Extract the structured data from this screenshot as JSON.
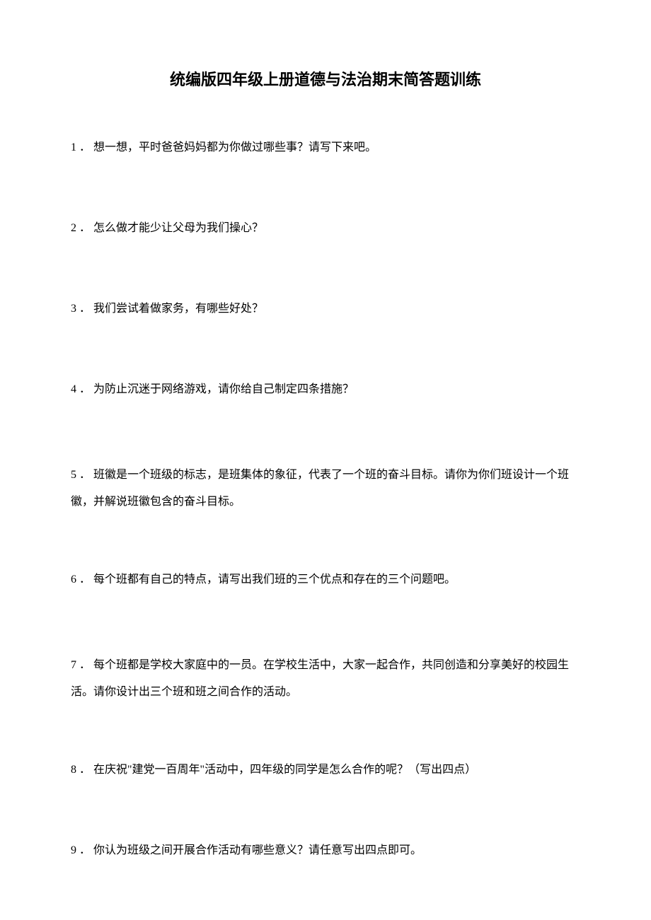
{
  "title": "统编版四年级上册道德与法治期末简答题训练",
  "questions": [
    {
      "num": "1",
      "text": "想一想，平时爸爸妈妈都为你做过哪些事？请写下来吧。"
    },
    {
      "num": "2",
      "text": "怎么做才能少让父母为我们操心？"
    },
    {
      "num": "3",
      "text": "我们尝试着做家务，有哪些好处？"
    },
    {
      "num": "4",
      "text": "为防止沉迷于网络游戏，请你给自己制定四条措施？"
    },
    {
      "num": "5",
      "text": "班徽是一个班级的标志，是班集体的象征，代表了一个班的奋斗目标。请你为你们班设计一个班徽，并解说班徽包含的奋斗目标。"
    },
    {
      "num": "6",
      "text": "每个班都有自己的特点，请写出我们班的三个优点和存在的三个问题吧。"
    },
    {
      "num": "7",
      "text": "每个班都是学校大家庭中的一员。在学校生活中，大家一起合作，共同创造和分享美好的校园生活。请你设计出三个班和班之间合作的活动。"
    },
    {
      "num": "8",
      "text": "在庆祝\"建党一百周年\"活动中，四年级的同学是怎么合作的呢？（写出四点）"
    },
    {
      "num": "9",
      "text": "你认为班级之间开展合作活动有哪些意义？请任意写出四点即可。"
    }
  ],
  "dot": "．"
}
